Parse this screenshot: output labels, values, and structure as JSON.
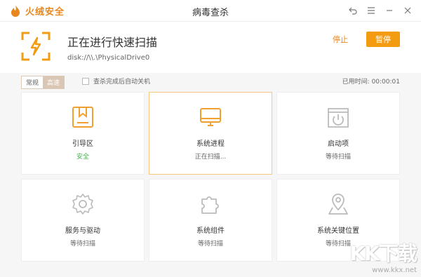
{
  "app": {
    "name": "火绒安全",
    "window_title": "病毒查杀",
    "brand_color": "#e8871e"
  },
  "header": {
    "title": "正在进行快速扫描",
    "path": "disk://\\\\.\\PhysicalDrive0",
    "stop_label": "停止",
    "pause_label": "暂停"
  },
  "options": {
    "modes": [
      "常规",
      "高速"
    ],
    "active_mode": "高速",
    "auto_shutdown_label": "查杀完成后自动关机",
    "elapsed_label": "已用时间: 00:00:01"
  },
  "cards": [
    {
      "name": "引导区",
      "status": "安全",
      "icon": "bookmark-icon"
    },
    {
      "name": "系统进程",
      "status": "正在扫描...",
      "icon": "monitor-icon"
    },
    {
      "name": "启动项",
      "status": "等待扫描",
      "icon": "power-icon"
    },
    {
      "name": "服务与驱动",
      "status": "等待扫描",
      "icon": "gear-icon"
    },
    {
      "name": "系统组件",
      "status": "等待扫描",
      "icon": "puzzle-icon"
    },
    {
      "name": "系统关键位置",
      "status": "等待扫描",
      "icon": "location-icon"
    }
  ],
  "watermark": {
    "brand": "KK下载",
    "url": "www.kkx.net"
  }
}
